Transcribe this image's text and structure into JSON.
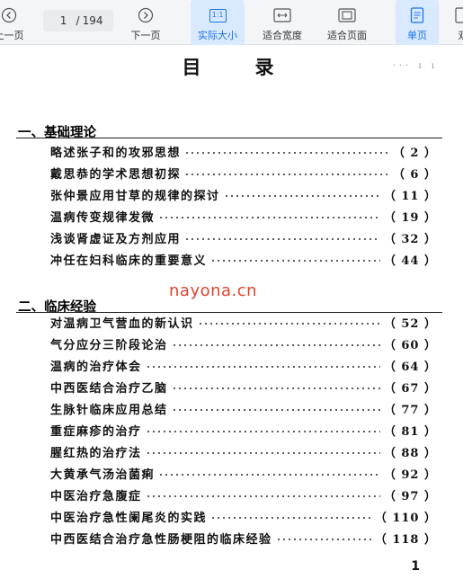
{
  "toolbar": {
    "prev_label": "上一页",
    "page_current": "1",
    "page_separator": "/",
    "page_total": "194",
    "next_label": "下一页",
    "actual_size_label": "实际大小",
    "actual_size_icon_text": "1:1",
    "fit_width_label": "适合宽度",
    "fit_page_label": "适合页面",
    "single_page_label": "单页",
    "double_page_label": "双"
  },
  "document": {
    "title": "目录",
    "corner_noise": "··· ı ı",
    "sections": [
      {
        "heading": "一、基础理论",
        "entries": [
          {
            "title": "略述张子和的攻邪思想",
            "page": "（ 2 ）"
          },
          {
            "title": "戴思恭的学术思想初探",
            "page": "（ 6 ）"
          },
          {
            "title": "张仲景应用甘草的规律的探讨",
            "page": "（ 11 ）"
          },
          {
            "title": "温病传变规律发微",
            "page": "（ 19 ）"
          },
          {
            "title": "浅谈肾虚证及方剂应用",
            "page": "（ 32 ）"
          },
          {
            "title": "冲任在妇科临床的重要意义",
            "page": "（ 44 ）"
          }
        ]
      },
      {
        "heading": "二、临床经验",
        "entries": [
          {
            "title": "对温病卫气营血的新认识",
            "page": "（ 52 ）"
          },
          {
            "title": "气分应分三阶段论治",
            "page": "（ 60 ）"
          },
          {
            "title": "温病的治疗体会",
            "page": "（ 64 ）"
          },
          {
            "title": "中西医结合治疗乙脑",
            "page": "（ 67 ）"
          },
          {
            "title": "生脉针临床应用总结",
            "page": "（ 77 ）"
          },
          {
            "title": "重症麻疹的治疗",
            "page": "（ 81 ）"
          },
          {
            "title": "腥红热的治疗法",
            "page": "（ 88 ）"
          },
          {
            "title": "大黄承气汤治菌痢",
            "page": "（ 92 ）"
          },
          {
            "title": "中医治疗急腹症",
            "page": "（ 97 ）"
          },
          {
            "title": "中医治疗急性阑尾炎的实践",
            "page": "（ 110 ）"
          },
          {
            "title": "中西医结合治疗急性肠梗阻的临床经验",
            "page": "（ 118 ）"
          }
        ]
      }
    ],
    "page_number": "1"
  },
  "watermark": "nayona.cn",
  "colors": {
    "accent": "#1a73e8",
    "active_bg": "#d9e9ff",
    "watermark": "#e0432e"
  }
}
